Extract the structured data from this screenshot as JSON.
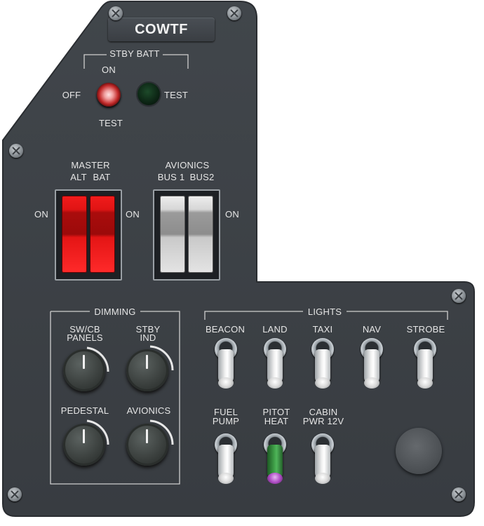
{
  "panel": {
    "title": "COWTF",
    "colors": {
      "panel": "#3b3f44",
      "text": "#e6e6e6",
      "master_switch": "#e01414",
      "avionics_switch": "#d6d6d6",
      "pitot_lever": "#3f9f48"
    }
  },
  "stby_batt": {
    "group_label": "STBY BATT",
    "on_label": "ON",
    "off_label": "OFF",
    "test_below_label": "TEST",
    "test_right_label": "TEST"
  },
  "master": {
    "title": "MASTER",
    "alt_label": "ALT",
    "bat_label": "BAT",
    "on_left": "ON",
    "on_right": "ON"
  },
  "avionics_bus": {
    "title": "AVIONICS",
    "bus1_label": "BUS 1",
    "bus2_label": "BUS2",
    "on_right": "ON"
  },
  "dimming": {
    "group_label": "DIMMING",
    "knobs": [
      {
        "label_l1": "SW/CB",
        "label_l2": "PANELS"
      },
      {
        "label_l1": "STBY",
        "label_l2": "IND"
      },
      {
        "label_l1": "PEDESTAL",
        "label_l2": ""
      },
      {
        "label_l1": "AVIONICS",
        "label_l2": ""
      }
    ]
  },
  "lights": {
    "group_label": "LIGHTS",
    "switches": [
      {
        "label_l1": "BEACON",
        "label_l2": ""
      },
      {
        "label_l1": "LAND",
        "label_l2": ""
      },
      {
        "label_l1": "TAXI",
        "label_l2": ""
      },
      {
        "label_l1": "NAV",
        "label_l2": ""
      },
      {
        "label_l1": "STROBE",
        "label_l2": ""
      },
      {
        "label_l1": "FUEL",
        "label_l2": "PUMP"
      },
      {
        "label_l1": "PITOT",
        "label_l2": "HEAT"
      },
      {
        "label_l1": "CABIN",
        "label_l2": "PWR 12V"
      }
    ]
  }
}
